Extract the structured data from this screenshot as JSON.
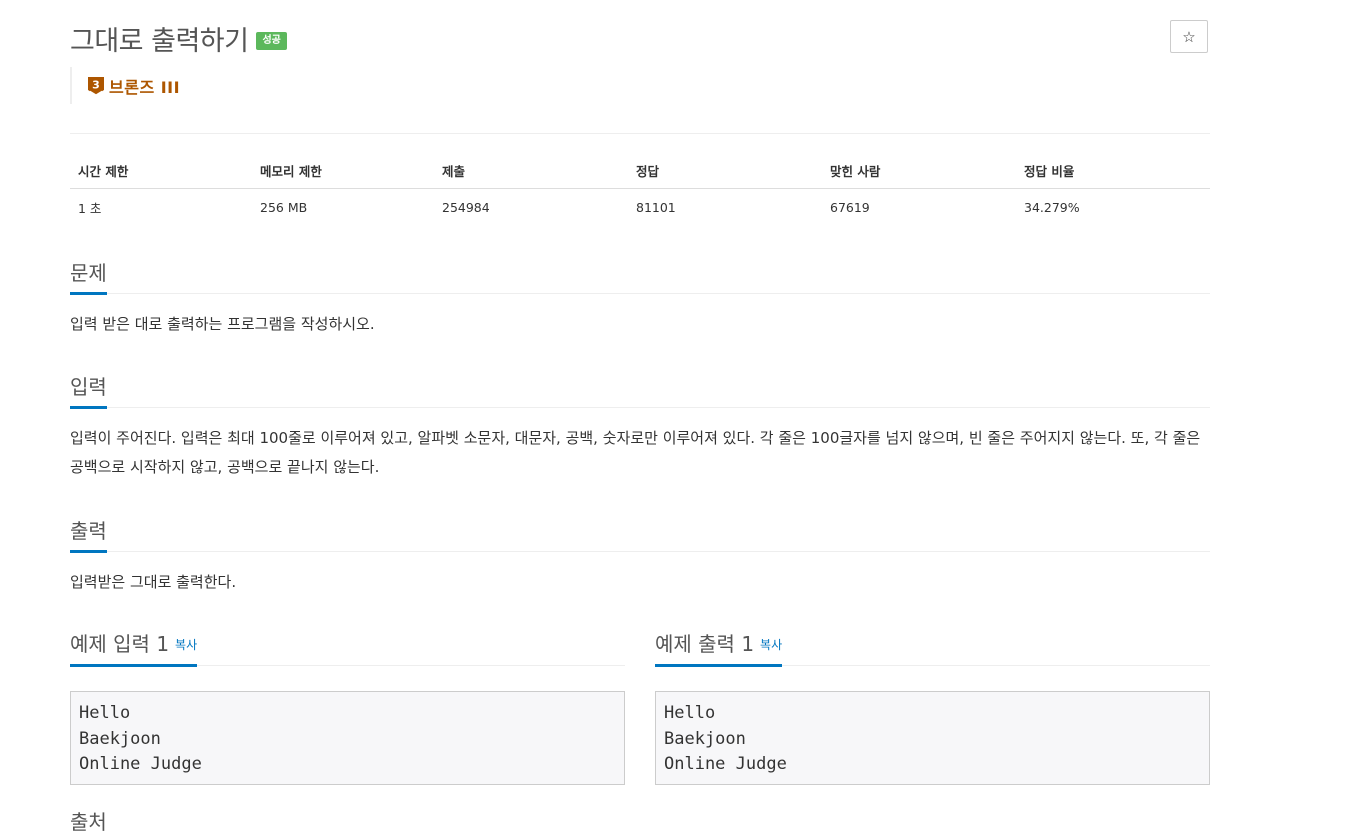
{
  "problem": {
    "title": "그대로 출력하기",
    "status_badge": "성공",
    "star_icon": "☆",
    "tier": {
      "label": "브론즈 III",
      "icon": "bronze-3-tier-icon",
      "color": "#ad5600"
    }
  },
  "info_table": {
    "headers": [
      "시간 제한",
      "메모리 제한",
      "제출",
      "정답",
      "맞힌 사람",
      "정답 비율"
    ],
    "values": [
      "1 초",
      "256 MB",
      "254984",
      "81101",
      "67619",
      "34.279%"
    ]
  },
  "sections": {
    "description": {
      "title": "문제",
      "text": "입력 받은 대로 출력하는 프로그램을 작성하시오."
    },
    "input": {
      "title": "입력",
      "text": "입력이 주어진다. 입력은 최대 100줄로 이루어져 있고, 알파벳 소문자, 대문자, 공백, 숫자로만 이루어져 있다. 각 줄은 100글자를 넘지 않으며, 빈 줄은 주어지지 않는다. 또, 각 줄은 공백으로 시작하지 않고, 공백으로 끝나지 않는다."
    },
    "output": {
      "title": "출력",
      "text": "입력받은 그대로 출력한다."
    },
    "next_partial": "출처"
  },
  "samples": {
    "input": {
      "title": "예제 입력 1",
      "copy_label": "복사",
      "content": "Hello\nBaekjoon\nOnline Judge"
    },
    "output": {
      "title": "예제 출력 1",
      "copy_label": "복사",
      "content": "Hello\nBaekjoon\nOnline Judge"
    }
  },
  "colors": {
    "accent": "#0076c0",
    "success": "#5cb85c",
    "bronze": "#ad5600"
  }
}
